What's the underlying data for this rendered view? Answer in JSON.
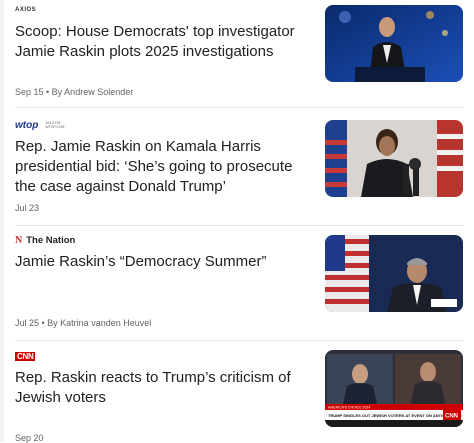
{
  "articles": [
    {
      "source_logo_text": "AXIOS",
      "source_name": "",
      "headline": "Scoop: House Democrats' top investigator Jamie Raskin plots 2025 investigations",
      "meta": "Sep 15 • By Andrew Solender",
      "thumbnail": "man in suit at podium with blue backdrop"
    },
    {
      "source_logo_text": "wtop",
      "source_logo_subtext": "103.5 FM WTOP.COM",
      "source_name": "",
      "headline": "Rep. Jamie Raskin on Kamala Harris presidential bid: ‘She’s going to prosecute the case against Donald Trump’",
      "meta": "Jul 23",
      "thumbnail": "woman speaking at microphones with american flags"
    },
    {
      "source_logo_text": "N",
      "source_name": "The Nation",
      "headline": "Jamie Raskin’s “Democracy Summer”",
      "meta": "Jul 25 • By Katrina vanden Heuvel",
      "thumbnail": "man speaking in committee room with american flag"
    },
    {
      "source_logo_text": "CNN",
      "source_name": "",
      "headline": "Rep. Raskin reacts to Trump’s criticism of Jewish voters",
      "meta": "Sep 20",
      "thumbnail": "cnn broadcast screenshot with two men",
      "thumbnail_banner": "TRUMP SINGLES OUT JEWISH VOTERS AT EVENT ON ANTISEMITISM"
    }
  ]
}
